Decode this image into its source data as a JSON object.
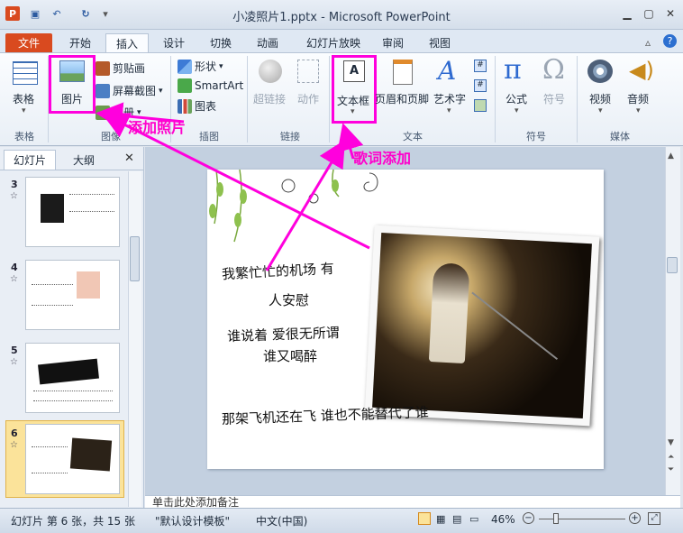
{
  "window": {
    "title": "小凌照片1.pptx - Microsoft PowerPoint"
  },
  "tabs": [
    "文件",
    "开始",
    "插入",
    "设计",
    "切换",
    "动画",
    "幻灯片放映",
    "审阅",
    "视图"
  ],
  "ribbon": {
    "groups": {
      "table": "表格",
      "images": "图像",
      "illustrations": "插图",
      "links": "链接",
      "text": "文本",
      "symbols": "符号",
      "media": "媒体"
    },
    "table_btn": "表格",
    "picture_btn": "图片",
    "clipart": "剪贴画",
    "screenshot": "屏幕截图",
    "album": "相册",
    "shapes": "形状",
    "smartart": "SmartArt",
    "chart": "图表",
    "hyperlink": "超链接",
    "action": "动作",
    "textbox": "文本框",
    "header_footer": "页眉和页脚",
    "wordart": "艺术字",
    "equation": "公式",
    "symbol": "符号",
    "video": "视频",
    "audio": "音频"
  },
  "panel": {
    "tabs": [
      "幻灯片",
      "大纲"
    ],
    "slides": [
      "3",
      "4",
      "5",
      "6"
    ]
  },
  "slide": {
    "lyrics": [
      "我繁忙忙的机场 有",
      "人安慰",
      "谁说着 爱很无所谓",
      "谁又喝醉",
      "那架飞机还在飞 谁也不能替代了谁"
    ]
  },
  "annotations": {
    "add_photo": "添加照片",
    "add_lyrics": "歌词添加"
  },
  "notes": {
    "placeholder": "单击此处添加备注"
  },
  "status": {
    "slide_info": "幻灯片 第 6 张，共 15 张",
    "theme": "\"默认设计模板\"",
    "language": "中文(中国)",
    "zoom": "46%"
  },
  "colors": {
    "file_tab": "#d94a1f",
    "highlight": "#ff00dd",
    "annotation": "#ff00cc"
  }
}
